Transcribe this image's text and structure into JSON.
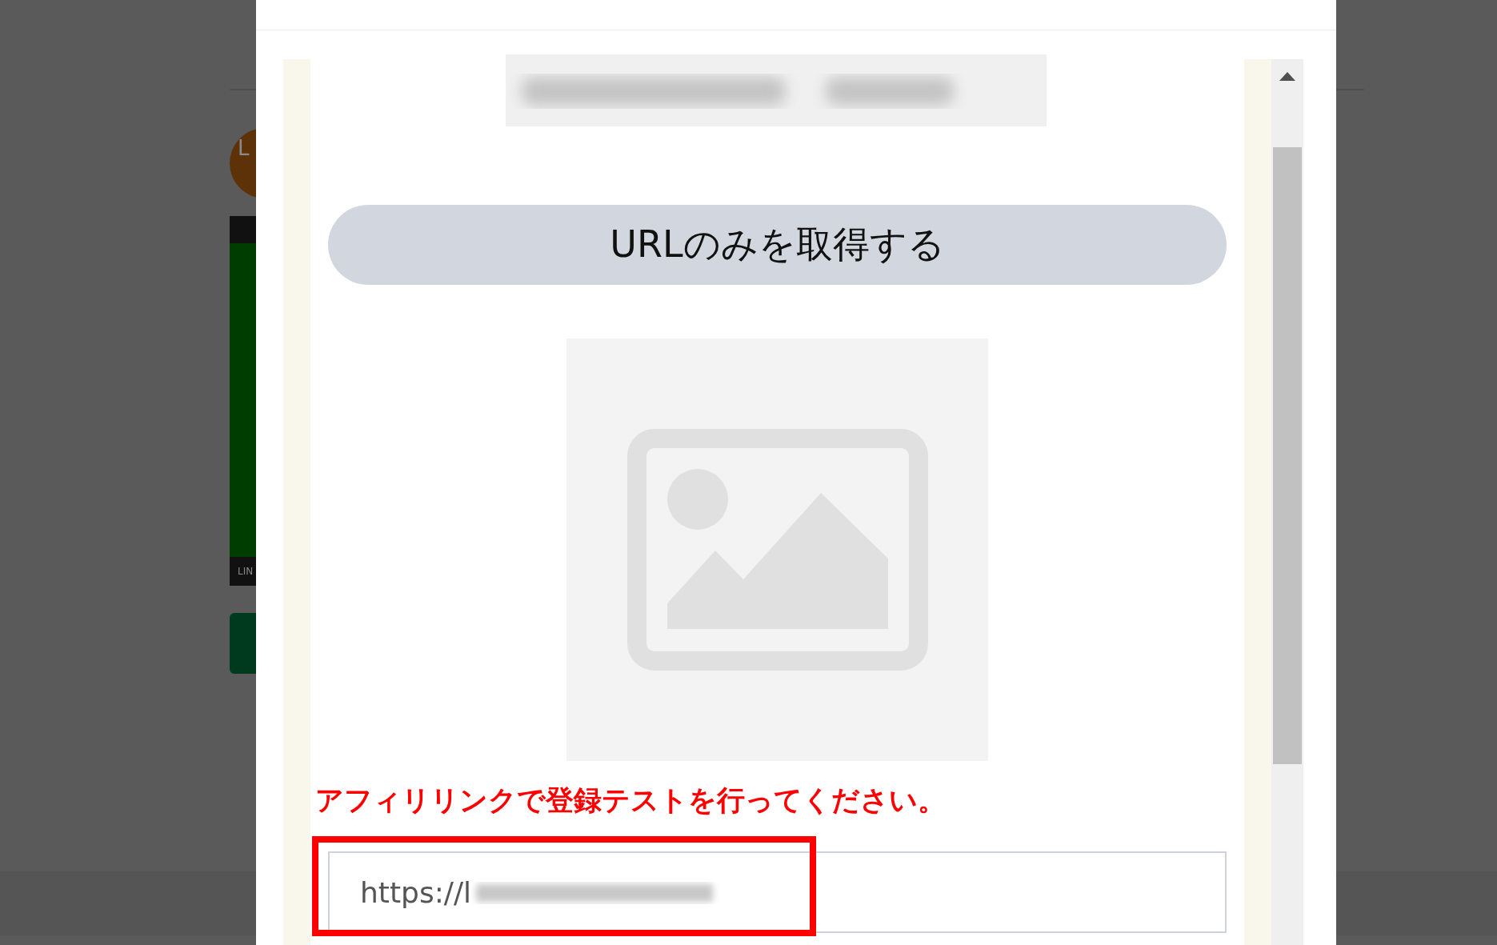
{
  "background_page": {
    "avatar_text": "L",
    "banner_footer": "LIN"
  },
  "dialog": {
    "button": "URLのみを取得する",
    "notice": "アフィリリンクで登録テストを行ってください。",
    "url_field": {
      "value": "https://l"
    }
  }
}
